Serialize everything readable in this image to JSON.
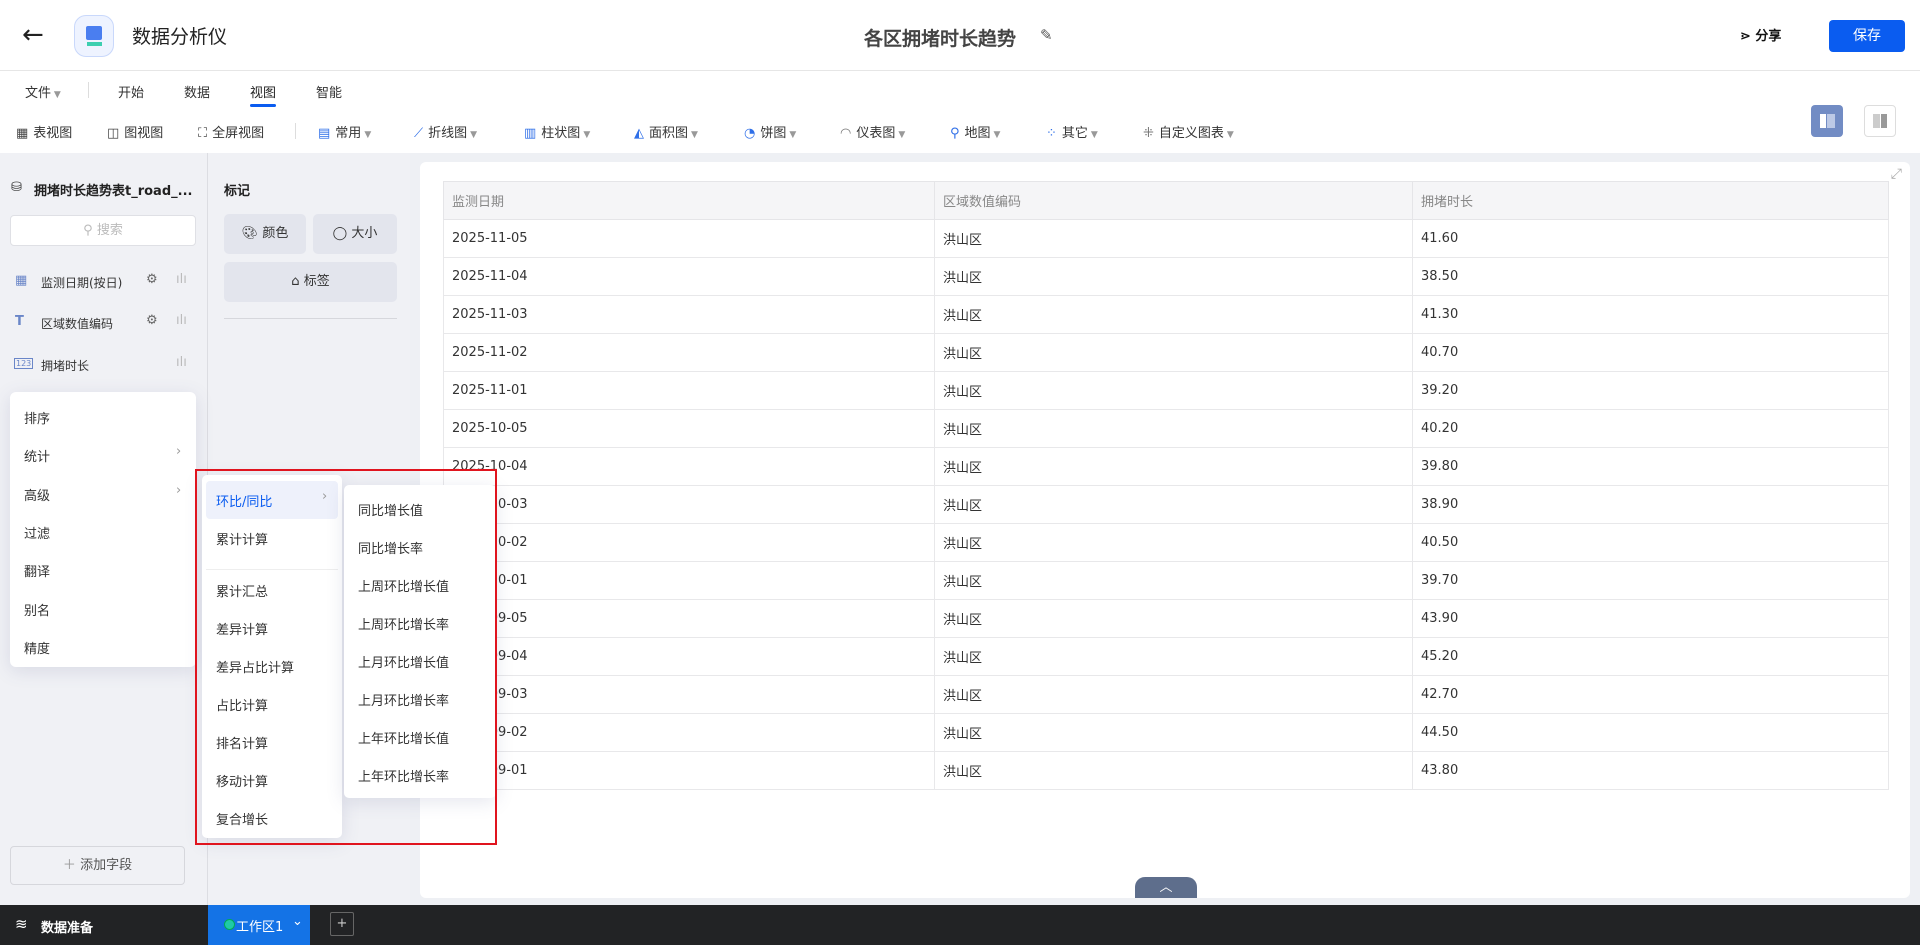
{
  "header": {
    "app_title": "数据分析仪",
    "doc_title": "各区拥堵时长趋势",
    "share": "分享",
    "save": "保存"
  },
  "tabs": [
    "文件",
    "开始",
    "数据",
    "视图",
    "智能"
  ],
  "toolbar": [
    "表视图",
    "图视图",
    "全屏视图",
    "常用",
    "折线图",
    "柱状图",
    "面积图",
    "饼图",
    "仪表图",
    "地图",
    "其它",
    "自定义图表"
  ],
  "sidebar": {
    "dataset": "拥堵时长趋势表t_road_...",
    "search_placeholder": "搜索",
    "fields": [
      "监测日期(按日)",
      "区域数值编码",
      "拥堵时长"
    ],
    "add_field": "添加字段"
  },
  "marks": {
    "title": "标记",
    "color": "颜色",
    "size": "大小",
    "label": "标签"
  },
  "context_menu": [
    "排序",
    "统计",
    "高级",
    "过滤",
    "翻译",
    "别名",
    "精度"
  ],
  "submenu_advanced": [
    "环比/同比",
    "累计计算",
    "累计汇总",
    "差异计算",
    "差异占比计算",
    "占比计算",
    "排名计算",
    "移动计算",
    "复合增长"
  ],
  "submenu_yoy": [
    "同比增长值",
    "同比增长率",
    "上周环比增长值",
    "上周环比增长率",
    "上月环比增长值",
    "上月环比增长率",
    "上年环比增长值",
    "上年环比增长率"
  ],
  "table": {
    "columns": [
      "监测日期",
      "区域数值编码",
      "拥堵时长"
    ],
    "rows": [
      [
        "2025-11-05",
        "洪山区",
        "41.60"
      ],
      [
        "2025-11-04",
        "洪山区",
        "38.50"
      ],
      [
        "2025-11-03",
        "洪山区",
        "41.30"
      ],
      [
        "2025-11-02",
        "洪山区",
        "40.70"
      ],
      [
        "2025-11-01",
        "洪山区",
        "39.20"
      ],
      [
        "2025-10-05",
        "洪山区",
        "40.20"
      ],
      [
        "2025-10-04",
        "洪山区",
        "39.80"
      ],
      [
        "2025-10-03",
        "洪山区",
        "38.90"
      ],
      [
        "2025-10-02",
        "洪山区",
        "40.50"
      ],
      [
        "2025-10-01",
        "洪山区",
        "39.70"
      ],
      [
        "2025-09-05",
        "洪山区",
        "43.90"
      ],
      [
        "2025-09-04",
        "洪山区",
        "45.20"
      ],
      [
        "2025-09-03",
        "洪山区",
        "42.70"
      ],
      [
        "2025-09-02",
        "洪山区",
        "44.50"
      ],
      [
        "2025-09-01",
        "洪山区",
        "43.80"
      ]
    ]
  },
  "bottom": {
    "data_prep": "数据准备",
    "workspace": "工作区1"
  },
  "colors": {
    "accent": "#0a5cf0",
    "highlight_box": "#e0141e"
  }
}
